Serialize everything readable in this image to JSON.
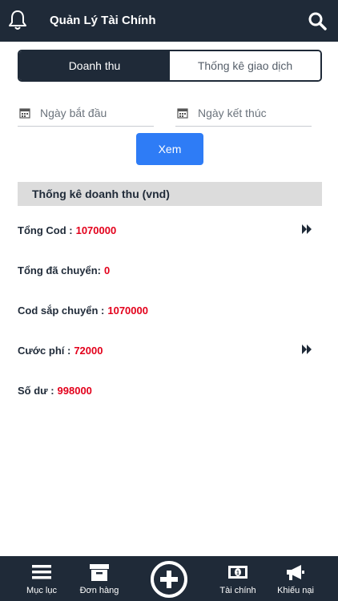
{
  "header": {
    "title": "Quản Lý Tài Chính"
  },
  "tabs": [
    {
      "label": "Doanh thu",
      "active": true
    },
    {
      "label": "Thống kê giao dịch",
      "active": false
    }
  ],
  "filters": {
    "start_date_placeholder": "Ngày bắt đầu",
    "end_date_placeholder": "Ngày kết thúc",
    "view_button": "Xem"
  },
  "section": {
    "title": "Thống kê doanh thu (vnd)"
  },
  "stats": [
    {
      "label": "Tổng Cod :",
      "value": "1070000"
    },
    {
      "label": "Tổng đã chuyển:",
      "value": "0"
    },
    {
      "label": "Cod sắp chuyển :",
      "value": "1070000"
    },
    {
      "label": "Cước phí :",
      "value": "72000"
    },
    {
      "label": "Số dư :",
      "value": "998000"
    }
  ],
  "bottom_nav": [
    {
      "label": "Mục lục",
      "icon": "menu-icon"
    },
    {
      "label": "Đơn hàng",
      "icon": "archive-box-icon"
    },
    {
      "label": "",
      "icon": "plus-icon"
    },
    {
      "label": "Tài chính",
      "icon": "money-icon"
    },
    {
      "label": "Khiếu nại",
      "icon": "megaphone-icon"
    }
  ],
  "colors": {
    "primary": "#1f2a38",
    "accent": "#2e7cf6",
    "value_red": "#e3001b"
  }
}
